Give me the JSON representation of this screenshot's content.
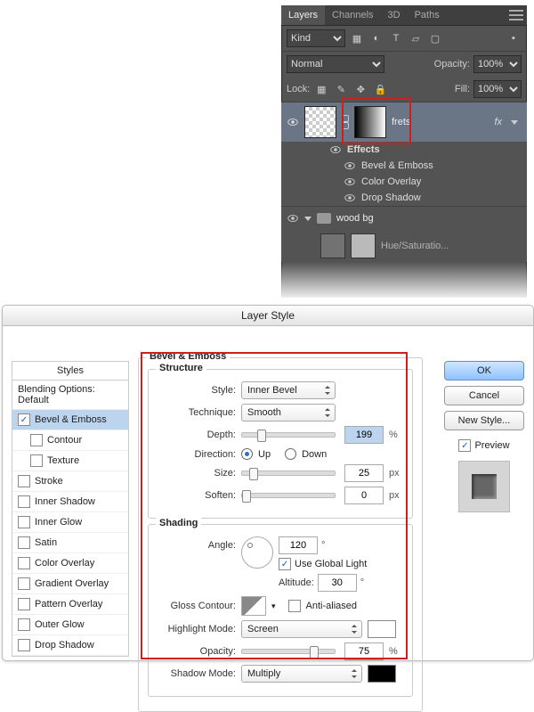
{
  "layers_panel": {
    "tabs": [
      "Layers",
      "Channels",
      "3D",
      "Paths"
    ],
    "kind_label": "Kind",
    "blend_mode": "Normal",
    "opacity_label": "Opacity:",
    "opacity_value": "100%",
    "lock_label": "Lock:",
    "fill_label": "Fill:",
    "fill_value": "100%",
    "layer_frets": "frets",
    "fx_label": "fx",
    "effects_label": "Effects",
    "effect_items": [
      "Bevel & Emboss",
      "Color Overlay",
      "Drop Shadow"
    ],
    "group_name": "wood bg",
    "adj_layer": "Hue/Saturatio..."
  },
  "dialog": {
    "title": "Layer Style",
    "left": {
      "header": "Styles",
      "items": [
        {
          "label": "Blending Options: Default",
          "checked": false,
          "sub": false,
          "selected": false,
          "hasCheckbox": false
        },
        {
          "label": "Bevel & Emboss",
          "checked": true,
          "sub": false,
          "selected": true,
          "hasCheckbox": true
        },
        {
          "label": "Contour",
          "checked": false,
          "sub": true,
          "selected": false,
          "hasCheckbox": true
        },
        {
          "label": "Texture",
          "checked": false,
          "sub": true,
          "selected": false,
          "hasCheckbox": true
        },
        {
          "label": "Stroke",
          "checked": false,
          "sub": false,
          "selected": false,
          "hasCheckbox": true
        },
        {
          "label": "Inner Shadow",
          "checked": false,
          "sub": false,
          "selected": false,
          "hasCheckbox": true
        },
        {
          "label": "Inner Glow",
          "checked": false,
          "sub": false,
          "selected": false,
          "hasCheckbox": true
        },
        {
          "label": "Satin",
          "checked": false,
          "sub": false,
          "selected": false,
          "hasCheckbox": true
        },
        {
          "label": "Color Overlay",
          "checked": false,
          "sub": false,
          "selected": false,
          "hasCheckbox": true
        },
        {
          "label": "Gradient Overlay",
          "checked": false,
          "sub": false,
          "selected": false,
          "hasCheckbox": true
        },
        {
          "label": "Pattern Overlay",
          "checked": false,
          "sub": false,
          "selected": false,
          "hasCheckbox": true
        },
        {
          "label": "Outer Glow",
          "checked": false,
          "sub": false,
          "selected": false,
          "hasCheckbox": true
        },
        {
          "label": "Drop Shadow",
          "checked": false,
          "sub": false,
          "selected": false,
          "hasCheckbox": true
        }
      ]
    },
    "center": {
      "section_title": "Bevel & Emboss",
      "structure_title": "Structure",
      "style_label": "Style:",
      "style_value": "Inner Bevel",
      "technique_label": "Technique:",
      "technique_value": "Smooth",
      "depth_label": "Depth:",
      "depth_value": "199",
      "depth_unit": "%",
      "direction_label": "Direction:",
      "direction_up": "Up",
      "direction_down": "Down",
      "size_label": "Size:",
      "size_value": "25",
      "size_unit": "px",
      "soften_label": "Soften:",
      "soften_value": "0",
      "soften_unit": "px",
      "shading_title": "Shading",
      "angle_label": "Angle:",
      "angle_value": "120",
      "angle_unit": "°",
      "global_light": "Use Global Light",
      "altitude_label": "Altitude:",
      "altitude_value": "30",
      "altitude_unit": "°",
      "gloss_label": "Gloss Contour:",
      "antialiased": "Anti-aliased",
      "highlight_mode_label": "Highlight Mode:",
      "highlight_mode_value": "Screen",
      "opacity_label": "Opacity:",
      "opacity_value": "75",
      "opacity_unit": "%",
      "shadow_mode_label": "Shadow Mode:",
      "shadow_mode_value": "Multiply"
    },
    "right": {
      "ok": "OK",
      "cancel": "Cancel",
      "new_style": "New Style...",
      "preview": "Preview"
    }
  }
}
